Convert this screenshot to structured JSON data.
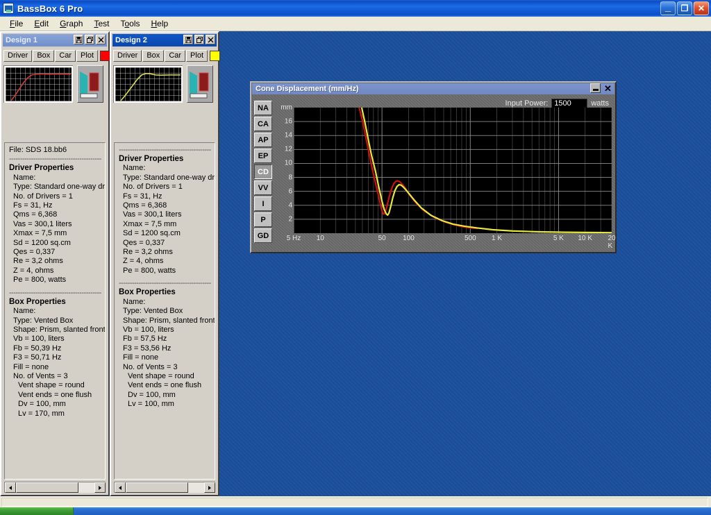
{
  "window": {
    "title": "BassBox 6 Pro",
    "icon": "app-icon",
    "buttons": {
      "minimize": "_",
      "maximize": "❐",
      "close": "✕"
    }
  },
  "menu": [
    {
      "label": "File",
      "accel": "F"
    },
    {
      "label": "Edit",
      "accel": "E"
    },
    {
      "label": "Graph",
      "accel": "G"
    },
    {
      "label": "Test",
      "accel": "T"
    },
    {
      "label": "Tools",
      "accel": "o"
    },
    {
      "label": "Help",
      "accel": "H"
    }
  ],
  "designs": [
    {
      "title": "Design 1",
      "active": false,
      "title_buttons": [
        "save-icon",
        "restore-icon",
        "close-icon"
      ],
      "toolbar": {
        "driver": "Driver",
        "box": "Box",
        "car": "Car",
        "plot": "Plot"
      },
      "plot_color": "#ff0000",
      "file_line": "File: SDS 18.bb6",
      "rule": "------------------------------------------",
      "driver": {
        "heading": "Driver Properties",
        "lines": [
          {
            "text": "Name:",
            "indent": 1
          },
          {
            "text": "Type: Standard one-way driv",
            "indent": 1
          },
          {
            "text": "No. of Drivers = 1",
            "indent": 1
          },
          {
            "text": "Fs =  31, Hz",
            "indent": 1
          },
          {
            "text": "Qms =  6,368",
            "indent": 1
          },
          {
            "text": "Vas =  300,1 liters",
            "indent": 1
          },
          {
            "text": "Xmax =  7,5 mm",
            "indent": 1
          },
          {
            "text": "Sd = 1200 sq.cm",
            "indent": 1
          },
          {
            "text": "Qes =  0,337",
            "indent": 1
          },
          {
            "text": "Re =  3,2 ohms",
            "indent": 1
          },
          {
            "text": "Z =  4, ohms",
            "indent": 1
          },
          {
            "text": "Pe =  800, watts",
            "indent": 1
          }
        ]
      },
      "box": {
        "heading": "Box Properties",
        "lines": [
          {
            "text": "Name:",
            "indent": 1
          },
          {
            "text": "Type: Vented Box",
            "indent": 1
          },
          {
            "text": "Shape: Prism, slanted front",
            "indent": 1
          },
          {
            "text": "Vb =  100, liters",
            "indent": 1
          },
          {
            "text": "Fb =  50,39 Hz",
            "indent": 1
          },
          {
            "text": "F3 =  50,71 Hz",
            "indent": 1
          },
          {
            "text": "Fill = none",
            "indent": 1
          },
          {
            "text": "No. of Vents = 3",
            "indent": 1
          },
          {
            "text": "Vent shape = round",
            "indent": 2
          },
          {
            "text": "Vent ends = one flush",
            "indent": 2
          },
          {
            "text": "Dv =  100, mm",
            "indent": 2
          },
          {
            "text": "Lv =  170, mm",
            "indent": 2
          }
        ]
      }
    },
    {
      "title": "Design 2",
      "active": true,
      "title_buttons": [
        "save-icon",
        "restore-icon",
        "close-icon"
      ],
      "toolbar": {
        "driver": "Driver",
        "box": "Box",
        "car": "Car",
        "plot": "Plot"
      },
      "plot_color": "#ffff00",
      "file_line": "",
      "rule": "------------------------------------------",
      "driver": {
        "heading": "Driver Properties",
        "lines": [
          {
            "text": "Name:",
            "indent": 1
          },
          {
            "text": "Type: Standard one-way driv",
            "indent": 1
          },
          {
            "text": "No. of Drivers = 1",
            "indent": 1
          },
          {
            "text": "Fs =  31, Hz",
            "indent": 1
          },
          {
            "text": "Qms =  6,368",
            "indent": 1
          },
          {
            "text": "Vas =  300,1 liters",
            "indent": 1
          },
          {
            "text": "Xmax =  7,5 mm",
            "indent": 1
          },
          {
            "text": "Sd = 1200 sq.cm",
            "indent": 1
          },
          {
            "text": "Qes =  0,337",
            "indent": 1
          },
          {
            "text": "Re =  3,2 ohms",
            "indent": 1
          },
          {
            "text": "Z =  4, ohms",
            "indent": 1
          },
          {
            "text": "Pe =  800, watts",
            "indent": 1
          }
        ]
      },
      "box": {
        "heading": "Box Properties",
        "lines": [
          {
            "text": "Name:",
            "indent": 1
          },
          {
            "text": "Type: Vented Box",
            "indent": 1
          },
          {
            "text": "Shape: Prism, slanted front",
            "indent": 1
          },
          {
            "text": "Vb =  100, liters",
            "indent": 1
          },
          {
            "text": "Fb =  57,5 Hz",
            "indent": 1
          },
          {
            "text": "F3 =  53,56 Hz",
            "indent": 1
          },
          {
            "text": "Fill = none",
            "indent": 1
          },
          {
            "text": "No. of Vents = 3",
            "indent": 1
          },
          {
            "text": "Vent shape = round",
            "indent": 2
          },
          {
            "text": "Vent ends = one flush",
            "indent": 2
          },
          {
            "text": "Dv =  100, mm",
            "indent": 2
          },
          {
            "text": "Lv =  100, mm",
            "indent": 2
          }
        ]
      }
    }
  ],
  "graph_window": {
    "title": "Cone Displacement (mm/Hz)",
    "minimize_label": "_",
    "close_label": "✕",
    "input_power": {
      "label": "Input Power:",
      "value": "1500",
      "units": "watts"
    },
    "side_buttons": [
      {
        "id": "NA",
        "selected": false
      },
      {
        "id": "CA",
        "selected": false
      },
      {
        "id": "AP",
        "selected": false
      },
      {
        "id": "EP",
        "selected": false
      },
      {
        "id": "CD",
        "selected": true
      },
      {
        "id": "VV",
        "selected": false
      },
      {
        "id": "I",
        "selected": false
      },
      {
        "id": "P",
        "selected": false
      },
      {
        "id": "GD",
        "selected": false
      }
    ]
  },
  "chart_data": {
    "type": "line",
    "title": "Cone Displacement (mm/Hz)",
    "xlabel": "",
    "ylabel": "mm",
    "x_scale": "log",
    "xlim": [
      5,
      20000
    ],
    "ylim": [
      0,
      18
    ],
    "grid": true,
    "legend_position": "none",
    "x_ticks": [
      {
        "value": 5,
        "label": "5 Hz"
      },
      {
        "value": 10,
        "label": "10"
      },
      {
        "value": 50,
        "label": "50"
      },
      {
        "value": 100,
        "label": "100"
      },
      {
        "value": 500,
        "label": "500"
      },
      {
        "value": 1000,
        "label": "1 K"
      },
      {
        "value": 5000,
        "label": "5 K"
      },
      {
        "value": 10000,
        "label": "10 K"
      },
      {
        "value": 20000,
        "label": "20 K"
      }
    ],
    "y_ticks": [
      {
        "value": 18,
        "label": "mm"
      },
      {
        "value": 16,
        "label": "16"
      },
      {
        "value": 14,
        "label": "14"
      },
      {
        "value": 12,
        "label": "12"
      },
      {
        "value": 10,
        "label": "10"
      },
      {
        "value": 8,
        "label": "8"
      },
      {
        "value": 6,
        "label": "6"
      },
      {
        "value": 4,
        "label": "4"
      },
      {
        "value": 2,
        "label": "2"
      }
    ],
    "series": [
      {
        "name": "Design 1",
        "color": "#cc1111",
        "x": [
          27,
          30,
          33,
          36,
          39,
          42,
          45,
          48,
          50,
          52,
          54,
          57,
          60,
          64,
          68,
          72,
          76,
          80,
          85,
          90,
          100,
          120,
          150,
          200,
          260,
          330,
          420,
          520,
          600
        ],
        "y": [
          18.4,
          16.2,
          13.6,
          11.2,
          9.1,
          7.3,
          5.7,
          4.1,
          3.2,
          2.75,
          2.9,
          3.9,
          5.1,
          6.3,
          7.1,
          7.45,
          7.5,
          7.35,
          7.0,
          6.6,
          5.7,
          4.4,
          3.2,
          2.2,
          1.6,
          1.2,
          0.9,
          0.75,
          0.68
        ]
      },
      {
        "name": "Design 2",
        "color": "#e8e83c",
        "x": [
          29,
          32,
          35,
          38,
          42,
          46,
          50,
          53,
          56,
          58,
          60,
          63,
          66,
          70,
          74,
          78,
          82,
          86,
          92,
          100,
          115,
          140,
          180,
          240,
          320,
          430,
          600,
          900,
          1500,
          3000,
          6000,
          12000,
          20000
        ],
        "y": [
          18.4,
          15.9,
          13.4,
          11.2,
          9.0,
          6.6,
          4.6,
          3.4,
          2.75,
          2.6,
          2.9,
          3.9,
          5.0,
          6.1,
          6.7,
          6.95,
          6.9,
          6.7,
          6.3,
          5.75,
          4.8,
          3.6,
          2.55,
          1.8,
          1.3,
          1.0,
          0.75,
          0.5,
          0.32,
          0.2,
          0.14,
          0.1,
          0.08
        ]
      }
    ]
  },
  "status_bar": {
    "text": ""
  },
  "colors": {
    "desktop": "#1b4f9c",
    "design1_plot": "#ff0000",
    "design2_plot": "#ffff00",
    "title_blue": "#0b4cc4"
  }
}
